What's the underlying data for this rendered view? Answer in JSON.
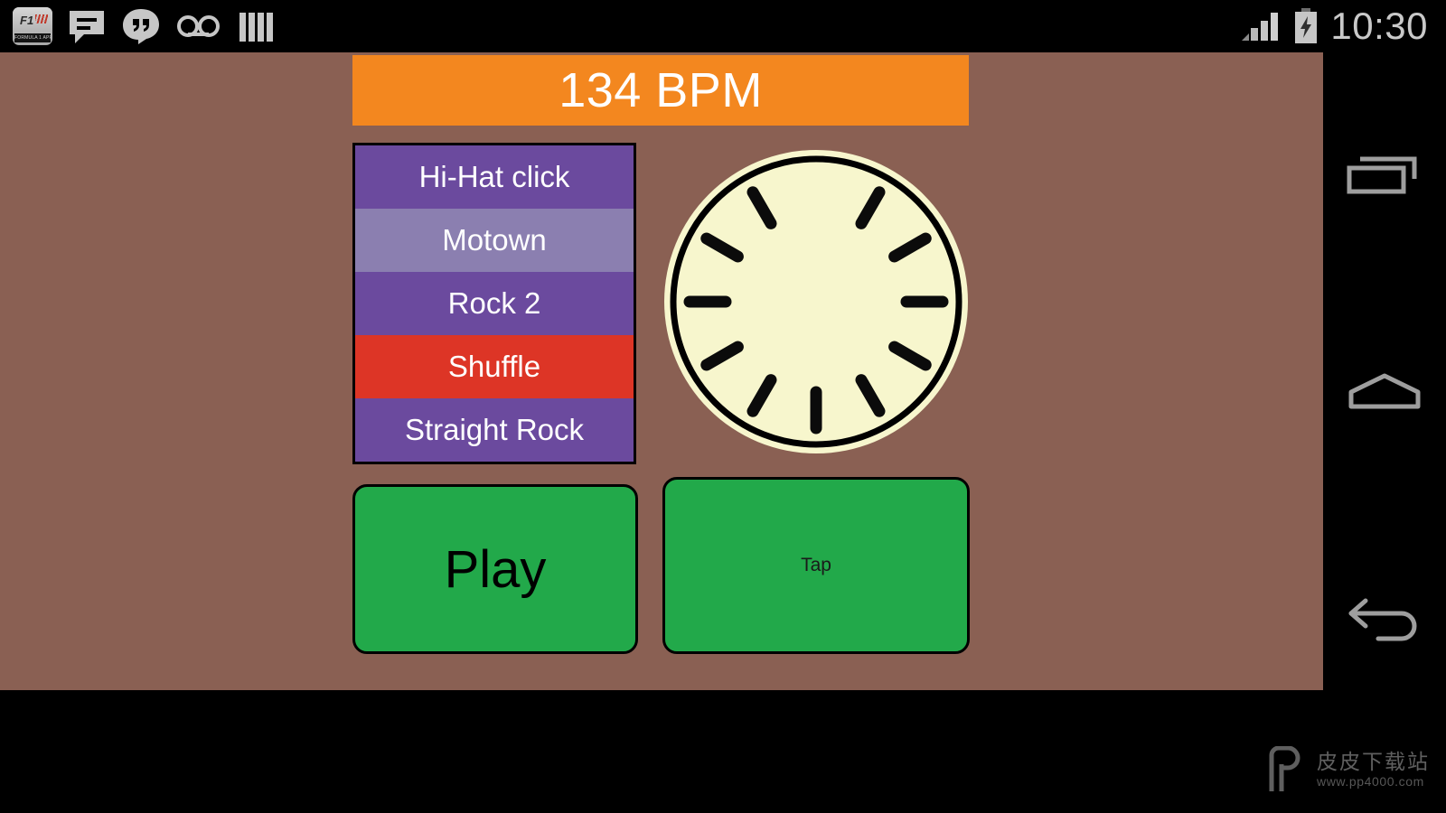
{
  "status_bar": {
    "time": "10:30",
    "left_icons": [
      {
        "name": "formula1-app-icon",
        "label": "FORMULA 1 APP",
        "mark": "F1"
      },
      {
        "name": "messaging-icon",
        "label": "Messaging"
      },
      {
        "name": "hangouts-icon",
        "label": "Hangouts"
      },
      {
        "name": "voicemail-icon",
        "label": "Voicemail"
      },
      {
        "name": "equalizer-icon",
        "label": "Music / Equalizer"
      }
    ],
    "right_icons": [
      {
        "name": "signal-bars-icon",
        "label": "Signal",
        "bars": 4
      },
      {
        "name": "battery-charging-icon",
        "label": "Battery charging"
      }
    ]
  },
  "app": {
    "background_color": "#8a6053",
    "bpm": {
      "display": "134 BPM",
      "value": 134,
      "unit": "BPM",
      "background_color": "#f3871f",
      "text_color": "#ffffff"
    },
    "pattern_list": {
      "items": [
        {
          "label": "Hi-Hat click",
          "color": "#6b4a9e",
          "state": "normal"
        },
        {
          "label": "Motown",
          "color": "#8b7fb0",
          "state": "highlighted"
        },
        {
          "label": "Rock 2",
          "color": "#6b4a9e",
          "state": "normal"
        },
        {
          "label": "Shuffle",
          "color": "#dd3526",
          "state": "selected"
        },
        {
          "label": "Straight Rock",
          "color": "#6b4a9e",
          "state": "normal"
        }
      ]
    },
    "dial": {
      "name": "beat-dial",
      "face_color": "#f7f6cd",
      "ring_color": "#000000",
      "tick_count": 12,
      "missing_tick_index": 0,
      "description": "Circular metronome beat indicator with 12 clock-style tick marks; the top tick is the current active position (blank)"
    },
    "play_button": {
      "label": "Play",
      "color": "#22a94a",
      "text_color": "#000000"
    },
    "tap_button": {
      "label": "Tap",
      "color": "#22a94a",
      "text_color": "#1a1a1a"
    }
  },
  "nav_bar": {
    "buttons": [
      {
        "name": "recents-button",
        "label": "Recents"
      },
      {
        "name": "home-button",
        "label": "Home"
      },
      {
        "name": "back-button",
        "label": "Back"
      }
    ]
  },
  "watermark": {
    "logo": "P",
    "cn_text": "皮皮下载站",
    "url": "www.pp4000.com"
  }
}
